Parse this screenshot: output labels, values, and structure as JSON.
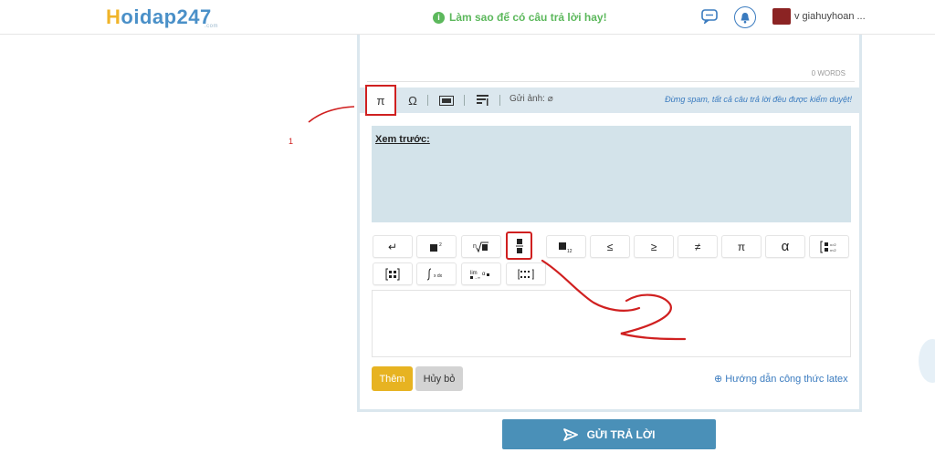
{
  "header": {
    "logo_first": "H",
    "logo_rest": "oidap247",
    "logo_sub": ".com",
    "tip": "Làm sao để có câu trả lời hay!",
    "username": "v giahuyhoan ..."
  },
  "editor": {
    "word_count": "0 WORDS"
  },
  "toolbar": {
    "pi": "π",
    "omega": "Ω",
    "attach_label": "Gửi ảnh:",
    "spam_note": "Đừng spam, tất cả câu trả lời đều được kiểm duyệt!"
  },
  "preview": {
    "label": "Xem trước:"
  },
  "math_symbols": {
    "row1": [
      "↵",
      "■²",
      "ⁿ√■",
      "frac",
      "■₁₂",
      "≤",
      "≥",
      "≠",
      "π",
      "α",
      "matrix-cases"
    ],
    "row2": [
      "matrix",
      "integral",
      "lim",
      "grid"
    ]
  },
  "actions": {
    "add": "Thêm",
    "cancel": "Hủy bỏ",
    "latex_help": "Hướng dẫn công thức latex"
  },
  "submit": {
    "label": "GỬI TRẢ LỜI"
  },
  "annotations": {
    "one": "1"
  },
  "colors": {
    "accent": "#4a90b8",
    "annotation": "#d02020",
    "add_button": "#e7b321"
  }
}
